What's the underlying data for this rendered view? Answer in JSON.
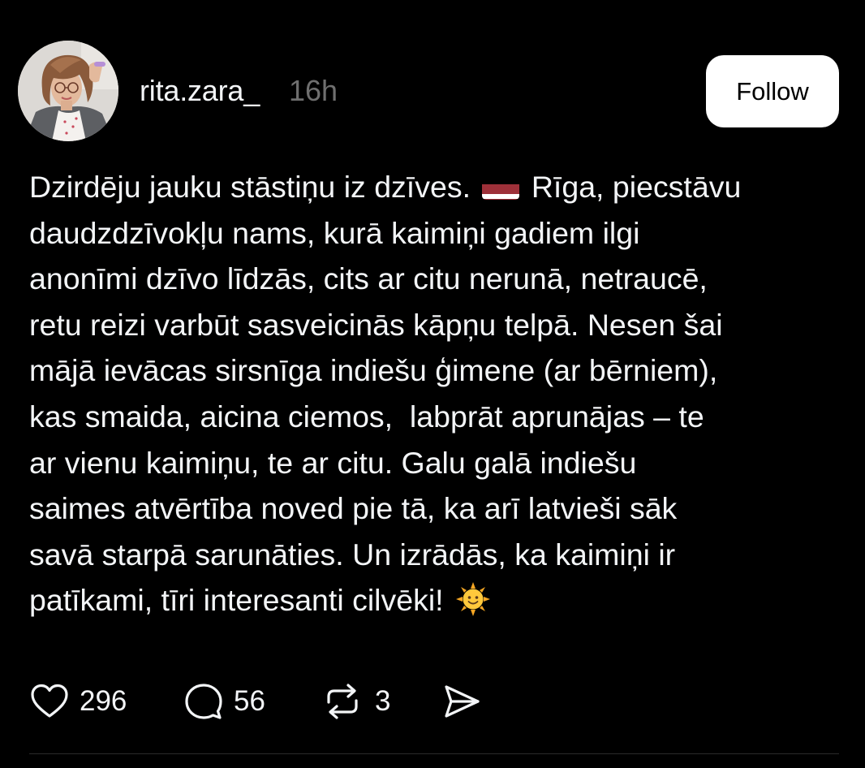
{
  "post": {
    "username": "rita.zara_",
    "timestamp": "16h",
    "follow_label": "Follow",
    "text_lines": [
      "Dzirdēju jauku stāstiņu iz dzīves.",
      "Rīga, piecstāvu",
      "daudzdzīvokļu nams, kurā kaimiņi gadiem ilgi",
      "anonīmi dzīvo līdzās, cits ar citu nerunā, netraucē,",
      "retu reizi varbūt sasveicinās kāpņu telpā. Nesen šai",
      "mājā ievācas sirsnīga indiešu ģimene (ar bērniem),",
      "kas smaida, aicina ciemos,  labprāt aprunājas – te",
      "ar vienu kaimiņu, te ar citu. Galu galā indiešu",
      "saimes atvērtība noved pie tā, ka arī latvieši sāk",
      "savā starpā sarunāties. Un izrādās, ka kaimiņi ir",
      "patīkami, tīri interesanti cilvēki!"
    ],
    "emojis": {
      "flag": "latvia-flag-emoji",
      "sun": "sun-with-face-emoji"
    },
    "actions": {
      "likes": "296",
      "replies": "56",
      "reposts": "3"
    }
  },
  "icons": {
    "like": "heart-icon",
    "reply": "comment-bubble-icon",
    "repost": "repost-arrows-icon",
    "share": "paper-plane-icon"
  },
  "colors": {
    "background": "#000000",
    "text": "#f3f5f7",
    "muted": "#6f6f6f",
    "button_bg": "#ffffff",
    "button_text": "#000000",
    "flag_red": "#9e3039"
  }
}
